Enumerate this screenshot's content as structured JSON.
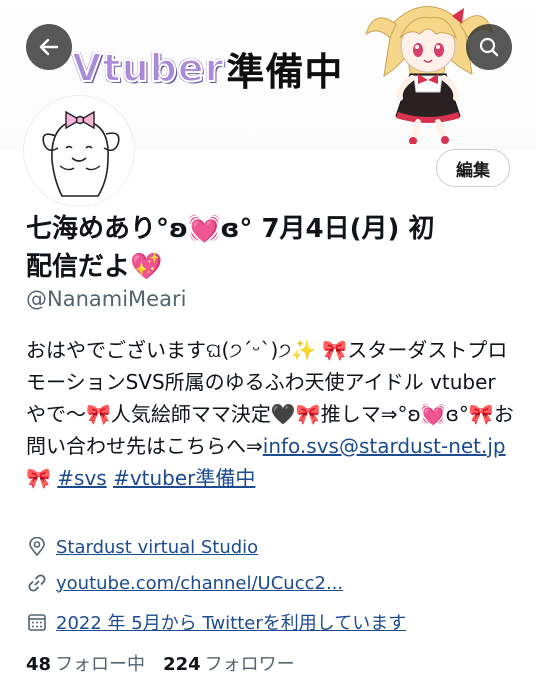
{
  "banner": {
    "title_latin": "Vtuber",
    "title_jp": "準備中"
  },
  "header": {
    "back_icon": "back-arrow-icon",
    "search_icon": "search-icon"
  },
  "profile": {
    "edit_label": "編集",
    "display_name": "七海めあり°ʚ💓ɞ° 7月4日(月) 初配信だよ💖",
    "handle": "@NanamiMeari",
    "bio_text": "おはやでございますଘ(੭ˊᵕˋ)੭✨ 🎀スターダストプロモーションSVS所属のゆるふわ天使アイドル vtuberやで〜🎀人気絵師ママ決定🖤🎀推しマ⇒°ʚ💓ɞ°🎀お問い合わせ先はこちらへ⇒",
    "bio_email": "info.svs@stardust-net.jp",
    "bio_sep": " 🎀 ",
    "bio_tag1": "#svs",
    "bio_tag2": "#vtuber準備中",
    "location": "Stardust virtual Studio",
    "website": "youtube.com/channel/UCucc2...",
    "joined": "2022 年 5月から Twitterを利用しています",
    "following_count": "48",
    "following_label": "フォロー中",
    "followers_count": "224",
    "followers_label": "フォロワー"
  },
  "colors": {
    "link": "#1d4b8f",
    "secondary_text": "#536471",
    "banner_accent": "#a98bd9"
  }
}
